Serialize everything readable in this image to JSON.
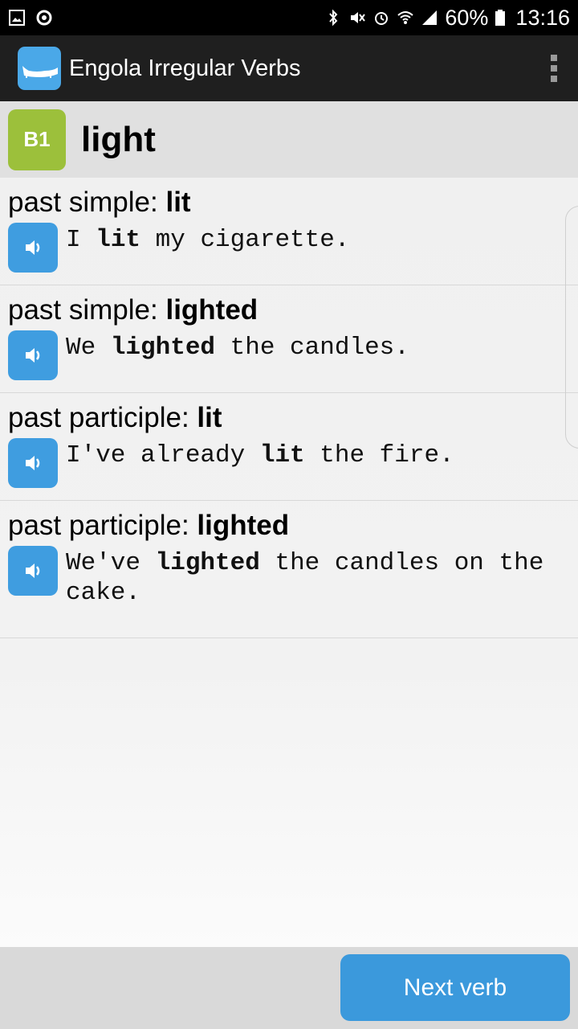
{
  "status_bar": {
    "battery": "60%",
    "time": "13:16",
    "icons": [
      "image-icon",
      "circle-icon",
      "bluetooth-icon",
      "mute-icon",
      "alarm-icon",
      "wifi-icon",
      "signal-icon",
      "battery-icon"
    ]
  },
  "app_bar": {
    "title": "Engola Irregular Verbs",
    "menu_icon": "overflow-menu-icon"
  },
  "verb": {
    "level": "B1",
    "word": "light"
  },
  "forms": [
    {
      "label": "past simple: ",
      "form": "lit",
      "example": {
        "before": "I ",
        "bold": "lit",
        "after": " my cigarette."
      }
    },
    {
      "label": "past simple: ",
      "form": "lighted",
      "example": {
        "before": "We ",
        "bold": "lighted",
        "after": " the candles."
      }
    },
    {
      "label": "past participle: ",
      "form": "lit",
      "example": {
        "before": "I've already ",
        "bold": "lit",
        "after": " the fire."
      }
    },
    {
      "label": "past participle: ",
      "form": "lighted",
      "example": {
        "before": "We've ",
        "bold": "lighted",
        "after": " the candles on the cake."
      }
    }
  ],
  "bottom": {
    "next_label": "Next verb"
  },
  "colors": {
    "accent": "#3b99dc",
    "level_badge": "#9cc03b",
    "app_bar": "#1f1f1f"
  }
}
